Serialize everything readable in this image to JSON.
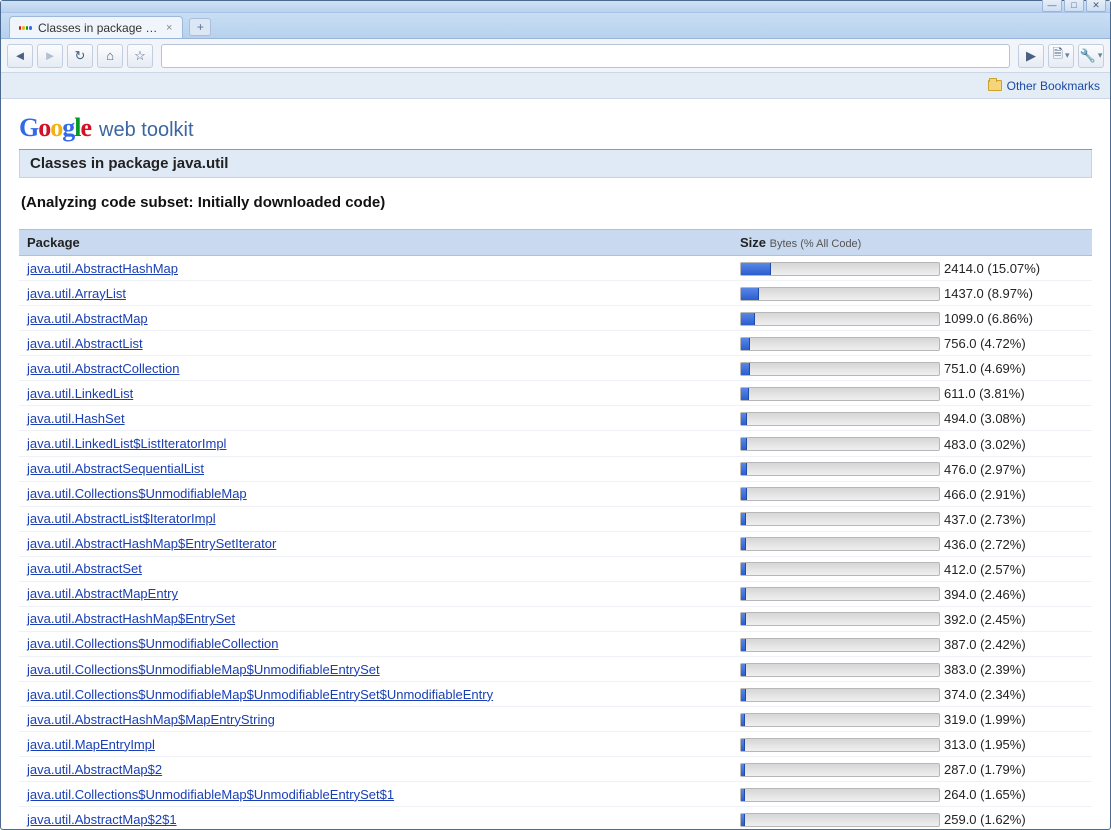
{
  "window": {
    "min_label": "—",
    "max_label": "□",
    "close_label": "✕"
  },
  "tab": {
    "title": "Classes in package j...",
    "close": "×",
    "new_tab": "+"
  },
  "toolbar": {
    "back": "◄",
    "forward": "►",
    "reload": "↻",
    "home": "⌂",
    "star": "☆",
    "address_value": "",
    "go": "▶",
    "page_menu": "🗎",
    "wrench": "🔧"
  },
  "bookmarks": {
    "other_bookmarks": "Other Bookmarks"
  },
  "header": {
    "google_letters": [
      "G",
      "o",
      "o",
      "g",
      "l",
      "e"
    ],
    "subtitle": "web toolkit",
    "section_title": "Classes in package java.util",
    "analyzing": "(Analyzing code subset: Initially downloaded code)"
  },
  "table": {
    "col_package": "Package",
    "col_size": "Size",
    "col_size_sub": "Bytes (% All Code)",
    "rows": [
      {
        "pkg": "java.util.AbstractHashMap",
        "bytes": "2414.0",
        "pct": "15.07%",
        "bar": 15.07
      },
      {
        "pkg": "java.util.ArrayList",
        "bytes": "1437.0",
        "pct": "8.97%",
        "bar": 8.97
      },
      {
        "pkg": "java.util.AbstractMap",
        "bytes": "1099.0",
        "pct": "6.86%",
        "bar": 6.86
      },
      {
        "pkg": "java.util.AbstractList",
        "bytes": "756.0",
        "pct": "4.72%",
        "bar": 4.72
      },
      {
        "pkg": "java.util.AbstractCollection",
        "bytes": "751.0",
        "pct": "4.69%",
        "bar": 4.69
      },
      {
        "pkg": "java.util.LinkedList",
        "bytes": "611.0",
        "pct": "3.81%",
        "bar": 3.81
      },
      {
        "pkg": "java.util.HashSet",
        "bytes": "494.0",
        "pct": "3.08%",
        "bar": 3.08
      },
      {
        "pkg": "java.util.LinkedList$ListIteratorImpl",
        "bytes": "483.0",
        "pct": "3.02%",
        "bar": 3.02
      },
      {
        "pkg": "java.util.AbstractSequentialList",
        "bytes": "476.0",
        "pct": "2.97%",
        "bar": 2.97
      },
      {
        "pkg": "java.util.Collections$UnmodifiableMap",
        "bytes": "466.0",
        "pct": "2.91%",
        "bar": 2.91
      },
      {
        "pkg": "java.util.AbstractList$IteratorImpl",
        "bytes": "437.0",
        "pct": "2.73%",
        "bar": 2.73
      },
      {
        "pkg": "java.util.AbstractHashMap$EntrySetIterator",
        "bytes": "436.0",
        "pct": "2.72%",
        "bar": 2.72
      },
      {
        "pkg": "java.util.AbstractSet",
        "bytes": "412.0",
        "pct": "2.57%",
        "bar": 2.57
      },
      {
        "pkg": "java.util.AbstractMapEntry",
        "bytes": "394.0",
        "pct": "2.46%",
        "bar": 2.46
      },
      {
        "pkg": "java.util.AbstractHashMap$EntrySet",
        "bytes": "392.0",
        "pct": "2.45%",
        "bar": 2.45
      },
      {
        "pkg": "java.util.Collections$UnmodifiableCollection",
        "bytes": "387.0",
        "pct": "2.42%",
        "bar": 2.42
      },
      {
        "pkg": "java.util.Collections$UnmodifiableMap$UnmodifiableEntrySet",
        "bytes": "383.0",
        "pct": "2.39%",
        "bar": 2.39
      },
      {
        "pkg": "java.util.Collections$UnmodifiableMap$UnmodifiableEntrySet$UnmodifiableEntry",
        "bytes": "374.0",
        "pct": "2.34%",
        "bar": 2.34
      },
      {
        "pkg": "java.util.AbstractHashMap$MapEntryString",
        "bytes": "319.0",
        "pct": "1.99%",
        "bar": 1.99
      },
      {
        "pkg": "java.util.MapEntryImpl",
        "bytes": "313.0",
        "pct": "1.95%",
        "bar": 1.95
      },
      {
        "pkg": "java.util.AbstractMap$2",
        "bytes": "287.0",
        "pct": "1.79%",
        "bar": 1.79
      },
      {
        "pkg": "java.util.Collections$UnmodifiableMap$UnmodifiableEntrySet$1",
        "bytes": "264.0",
        "pct": "1.65%",
        "bar": 1.65
      },
      {
        "pkg": "java.util.AbstractMap$2$1",
        "bytes": "259.0",
        "pct": "1.62%",
        "bar": 1.62
      }
    ]
  }
}
